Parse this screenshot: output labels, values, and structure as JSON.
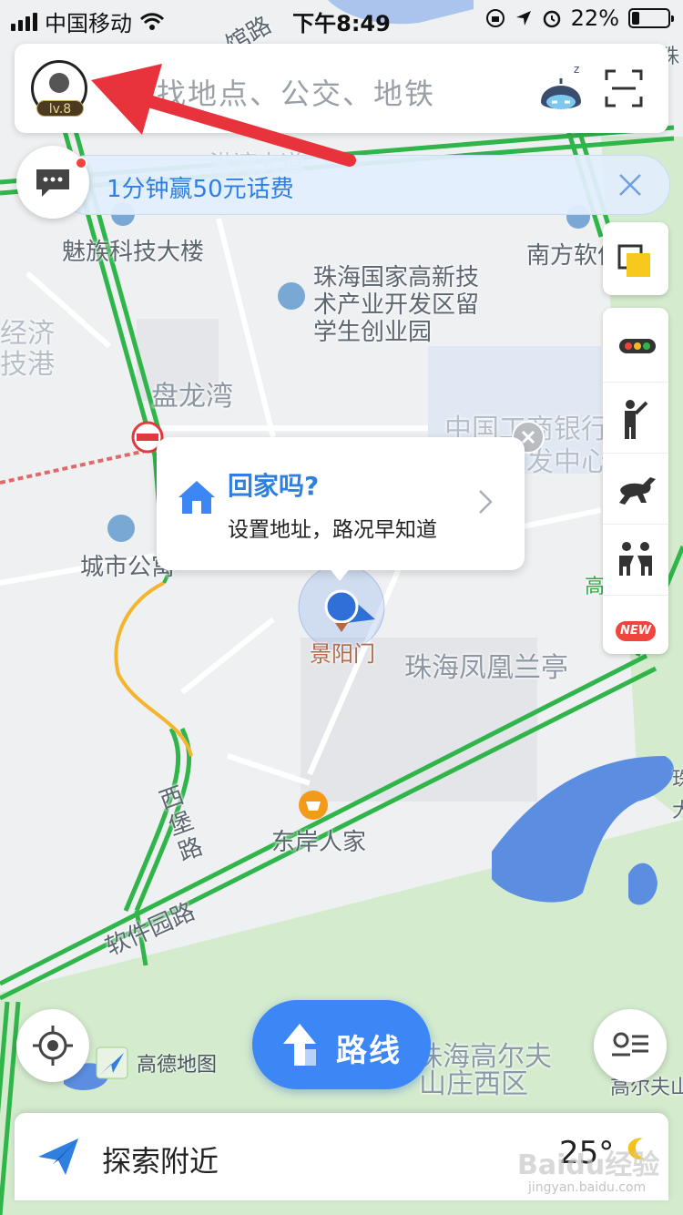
{
  "status_bar": {
    "carrier": "中国移动",
    "time": "下午8:49",
    "battery_text": "22%",
    "battery_level": 0.22
  },
  "search": {
    "placeholder": "查找地点、公交、地铁",
    "level": "lv.8"
  },
  "promo": {
    "text": "1分钟赢50元话费"
  },
  "popup": {
    "title": "回家吗?",
    "subtitle": "设置地址，路况早知道"
  },
  "toolbar": {
    "new_badge": "NEW"
  },
  "map": {
    "labels": {
      "meizu": "魅族科技大楼",
      "nanfang": "南方软件",
      "zhuhai_park": [
        "珠海国家高新技",
        "术产业开发区留",
        "学生创业园"
      ],
      "panlongwan": "盘龙湾",
      "icbc": [
        "中国工商银行",
        "发中心"
      ],
      "city_apartment": "城市公寓",
      "jingyangmen": "景阳门",
      "fenghuang": "珠海凤凰兰亭",
      "dongan": "东岸人家",
      "xibao_road": [
        "西",
        "堡",
        "路"
      ],
      "software_road": "软件园路",
      "golf": [
        "珠海高尔夫",
        "山庄西区"
      ],
      "golf_right": "高尔夫山",
      "economy": [
        "经济",
        "技港"
      ],
      "guanlu": "馆路",
      "gangwan": "港湾大道",
      "gao_right": "高  庄",
      "zhu_right": "珠",
      "edge_right": [
        "珠",
        "大"
      ]
    }
  },
  "bottom": {
    "route_label": "路线",
    "logo_text": "高德地图",
    "explore_label": "探索附近",
    "temperature": "25°",
    "watermark": "Baidu经验",
    "watermark_sub": "jingyan.baidu.com"
  },
  "colors": {
    "accent": "#3d86f5",
    "road_green": "#2fb54a",
    "road_yellow": "#f3b52b",
    "annotation_red": "#e8323c",
    "water": "#5b8ee0",
    "park": "#cfe8c8"
  }
}
